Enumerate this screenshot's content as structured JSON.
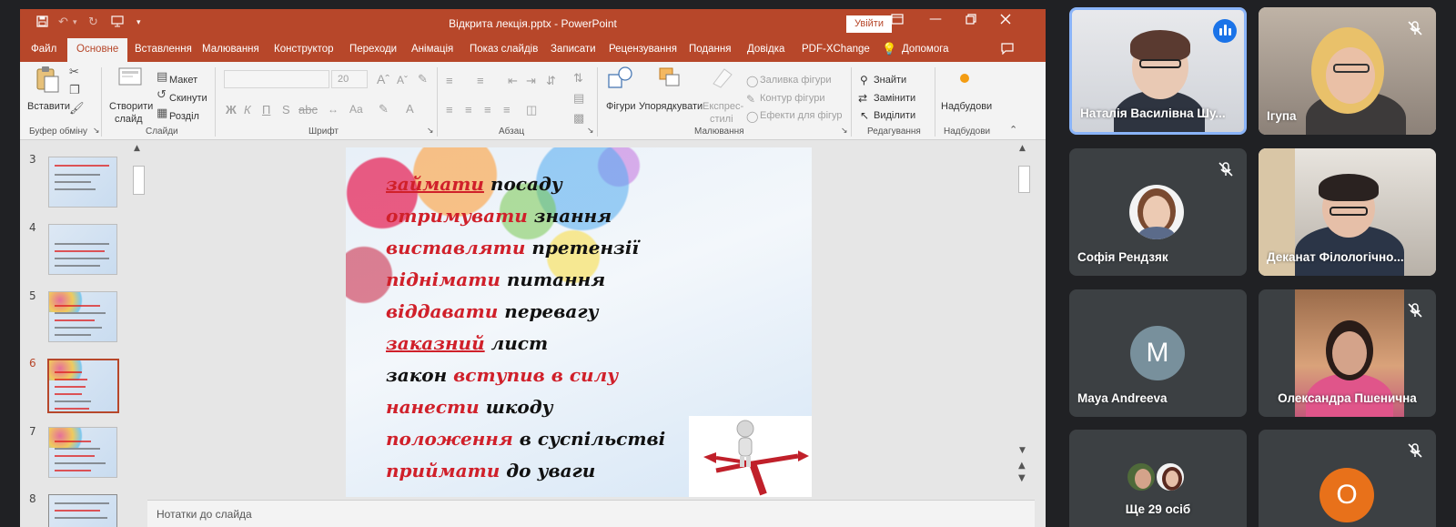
{
  "powerpoint": {
    "title_bar": {
      "document_title": "Відкрита лекція.pptx - PowerPoint",
      "sign_in_label": "Увійти"
    },
    "tabs": [
      "Файл",
      "Основне",
      "Вставлення",
      "Малювання",
      "Конструктор",
      "Переходи",
      "Анімація",
      "Показ слайдів",
      "Записати",
      "Рецензування",
      "Подання",
      "Довідка",
      "PDF-XChange",
      "Допомога"
    ],
    "active_tab": "Основне",
    "ribbon": {
      "clipboard": {
        "paste": "Вставити",
        "group": "Буфер обміну"
      },
      "slides": {
        "new_slide_1": "Створити",
        "new_slide_2": "слайд",
        "layout": "Макет",
        "reset": "Скинути",
        "section": "Розділ",
        "group": "Слайди"
      },
      "font": {
        "size": "20",
        "bold": "Ж",
        "italic": "К",
        "underline": "П",
        "strike": "S",
        "group": "Шрифт"
      },
      "paragraph": {
        "group": "Абзац"
      },
      "drawing": {
        "shapes": "Фігури",
        "arrange": "Упорядкувати",
        "quick_styles_1": "Експрес-",
        "quick_styles_2": "стилі",
        "shape_fill": "Заливка фігури",
        "shape_outline": "Контур фігури",
        "shape_effects": "Ефекти для фігур",
        "group": "Малювання"
      },
      "editing": {
        "find": "Знайти",
        "replace": "Замінити",
        "select": "Виділити",
        "group": "Редагування"
      },
      "addins": {
        "label": "Надбудови",
        "group": "Надбудови"
      }
    },
    "thumbnails": [
      {
        "number": "3"
      },
      {
        "number": "4"
      },
      {
        "number": "5"
      },
      {
        "number": "6",
        "active": true
      },
      {
        "number": "7"
      },
      {
        "number": "8"
      }
    ],
    "slide": {
      "lines": [
        {
          "red": "займати",
          "black": "посаду"
        },
        {
          "red": "отримувати",
          "black": "знання"
        },
        {
          "red": "виставляти",
          "black": "претензії"
        },
        {
          "red": "піднімати",
          "black": "питання"
        },
        {
          "red": "віддавати",
          "black": "перевагу"
        },
        {
          "red": "заказний",
          "black": "лист"
        },
        {
          "black": "закон",
          "red": "вступив в силу"
        },
        {
          "red": "нанести",
          "black": "шкоду"
        },
        {
          "red": "положення",
          "black": "в суспільстві"
        },
        {
          "red": "приймати",
          "black": "до уваги"
        }
      ]
    },
    "notes_label": "Нотатки до слайда",
    "colors": {
      "accent": "#b7472a",
      "slide_red": "#d0202a"
    }
  },
  "meet": {
    "participants": [
      {
        "name": "Наталія Василівна Шу...",
        "state": "speaking"
      },
      {
        "name": "Ігупа",
        "state": "muted"
      },
      {
        "name": "Софія Рендзяк",
        "state": "muted"
      },
      {
        "name": "Деканат Філологічно...",
        "state": "unmuted"
      },
      {
        "name": "Maya Andreeva",
        "state": "unmuted",
        "initial": "M",
        "avatar_color": "#78909c"
      },
      {
        "name": "Олександра Пшенична",
        "state": "muted"
      },
      {
        "name": "Ще 29 осіб",
        "state": "group"
      },
      {
        "name": "",
        "state": "muted",
        "initial": "O",
        "avatar_color": "#e8711a"
      }
    ],
    "colors": {
      "tile_bg": "#3c4043",
      "speaking_border": "#8ab4f8"
    }
  }
}
